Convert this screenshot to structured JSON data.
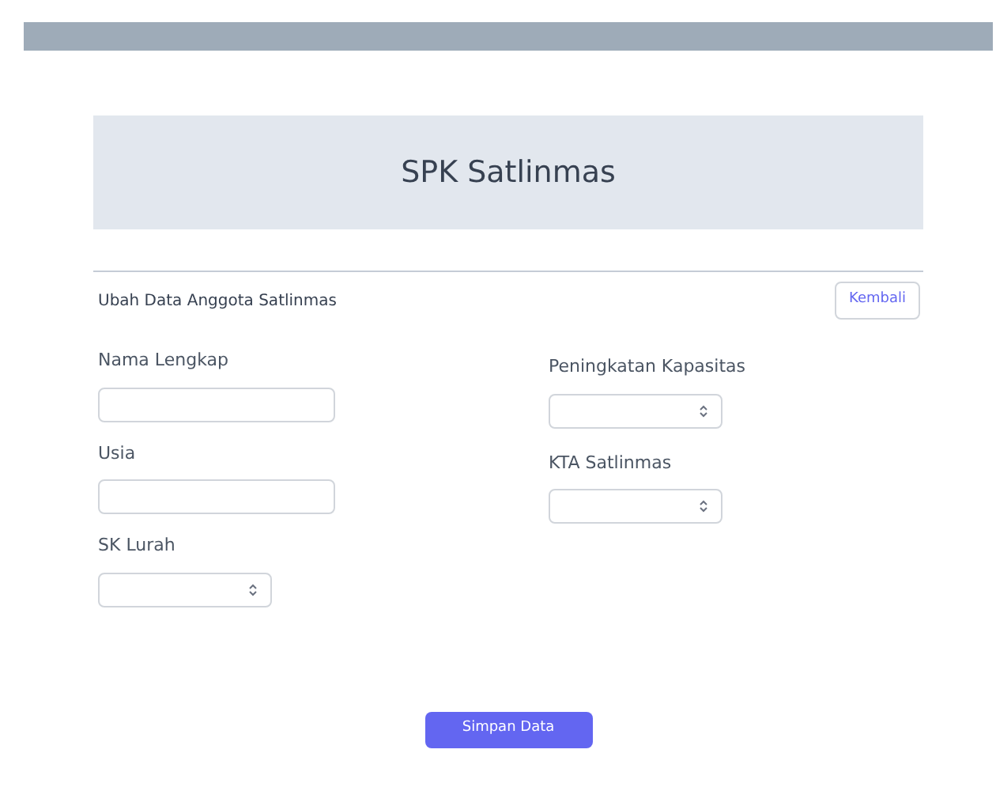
{
  "header": {
    "title": "SPK Satlinmas"
  },
  "section": {
    "title": "Ubah Data Anggota Satlinmas",
    "back_button": "Kembali"
  },
  "fields_left": [
    {
      "kind": "text",
      "label": "Nama Lengkap"
    },
    {
      "kind": "text",
      "label": "Usia"
    },
    {
      "kind": "select",
      "label": "SK Lurah"
    }
  ],
  "fields_right": [
    {
      "kind": "select",
      "label": "Peningkatan Kapasitas"
    },
    {
      "kind": "select",
      "label": "KTA Satlinmas"
    }
  ],
  "submit_button": "Simpan Data"
}
